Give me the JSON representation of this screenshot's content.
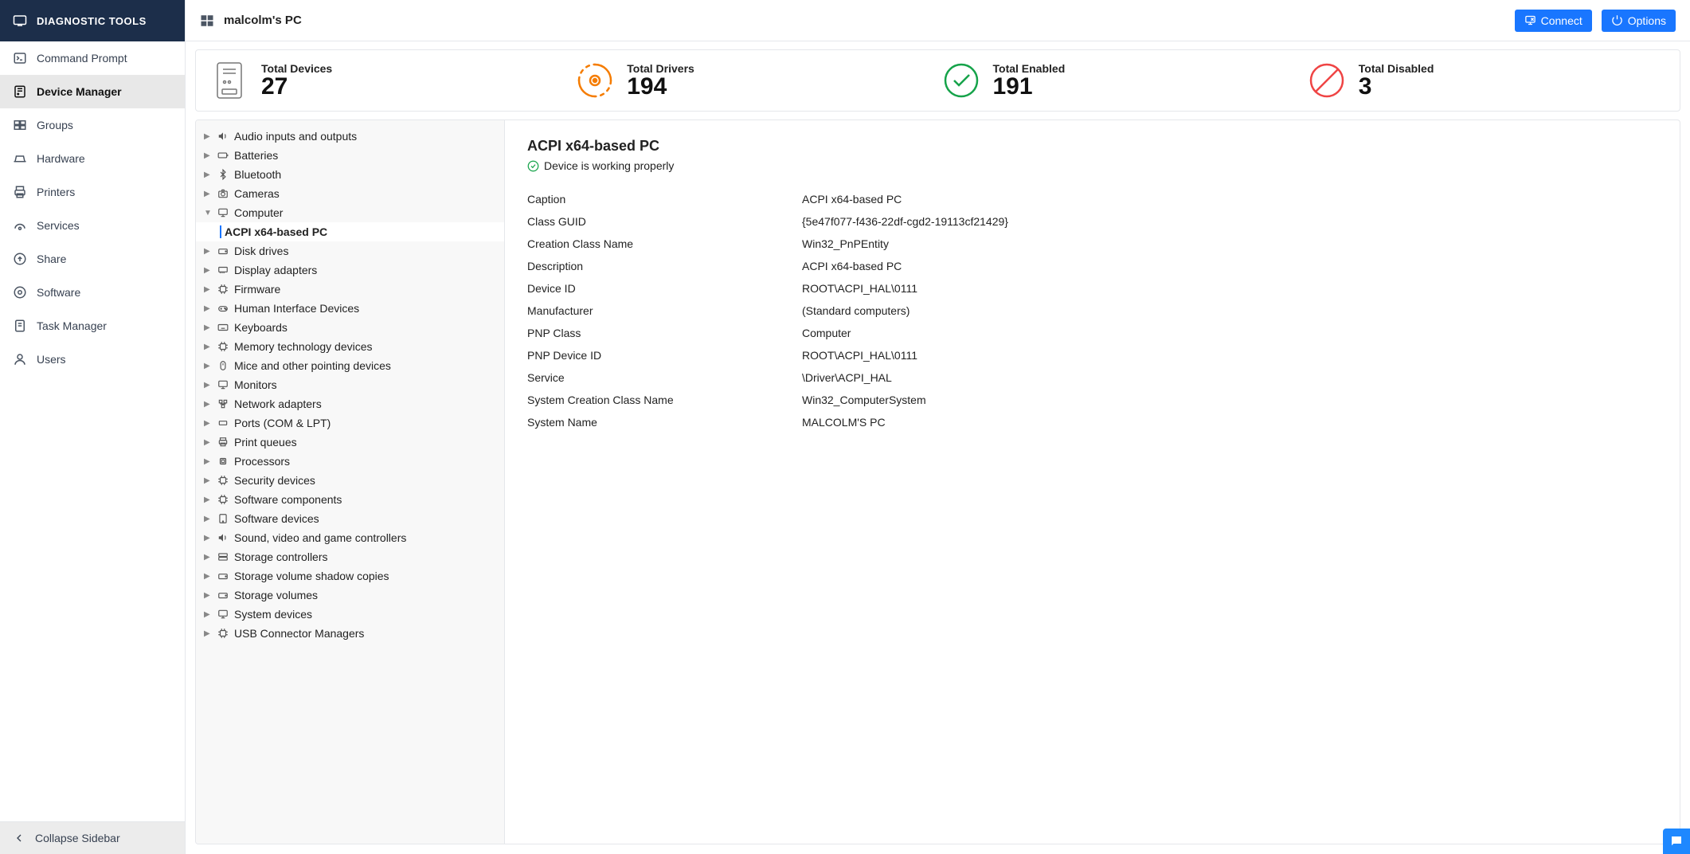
{
  "sidebar": {
    "title": "DIAGNOSTIC TOOLS",
    "items": [
      {
        "label": "Command Prompt"
      },
      {
        "label": "Device Manager"
      },
      {
        "label": "Groups"
      },
      {
        "label": "Hardware"
      },
      {
        "label": "Printers"
      },
      {
        "label": "Services"
      },
      {
        "label": "Share"
      },
      {
        "label": "Software"
      },
      {
        "label": "Task Manager"
      },
      {
        "label": "Users"
      }
    ],
    "collapse": "Collapse Sidebar"
  },
  "header": {
    "title": "malcolm's PC",
    "connect": "Connect",
    "options": "Options"
  },
  "stats": {
    "totalDevices": {
      "label": "Total Devices",
      "value": "27"
    },
    "totalDrivers": {
      "label": "Total Drivers",
      "value": "194"
    },
    "totalEnabled": {
      "label": "Total Enabled",
      "value": "191"
    },
    "totalDisabled": {
      "label": "Total Disabled",
      "value": "3"
    }
  },
  "tree": {
    "categories": [
      {
        "label": "Audio inputs and outputs"
      },
      {
        "label": "Batteries"
      },
      {
        "label": "Bluetooth"
      },
      {
        "label": "Cameras"
      },
      {
        "label": "Computer",
        "expanded": true,
        "children": [
          {
            "label": "ACPI x64-based PC",
            "selected": true
          }
        ]
      },
      {
        "label": "Disk drives"
      },
      {
        "label": "Display adapters"
      },
      {
        "label": "Firmware"
      },
      {
        "label": "Human Interface Devices"
      },
      {
        "label": "Keyboards"
      },
      {
        "label": "Memory technology devices"
      },
      {
        "label": "Mice and other pointing devices"
      },
      {
        "label": "Monitors"
      },
      {
        "label": "Network adapters"
      },
      {
        "label": "Ports (COM & LPT)"
      },
      {
        "label": "Print queues"
      },
      {
        "label": "Processors"
      },
      {
        "label": "Security devices"
      },
      {
        "label": "Software components"
      },
      {
        "label": "Software devices"
      },
      {
        "label": "Sound, video and game controllers"
      },
      {
        "label": "Storage controllers"
      },
      {
        "label": "Storage volume shadow copies"
      },
      {
        "label": "Storage volumes"
      },
      {
        "label": "System devices"
      },
      {
        "label": "USB Connector Managers"
      }
    ]
  },
  "details": {
    "title": "ACPI x64-based PC",
    "status": "Device is working properly",
    "rows": [
      {
        "k": "Caption",
        "v": "ACPI x64-based PC"
      },
      {
        "k": "Class GUID",
        "v": "{5e47f077-f436-22df-cgd2-19113cf21429}"
      },
      {
        "k": "Creation Class Name",
        "v": "Win32_PnPEntity"
      },
      {
        "k": "Description",
        "v": "ACPI x64-based PC"
      },
      {
        "k": "Device ID",
        "v": "ROOT\\ACPI_HAL\\0111"
      },
      {
        "k": "Manufacturer",
        "v": "(Standard computers)"
      },
      {
        "k": "PNP Class",
        "v": "Computer"
      },
      {
        "k": "PNP Device ID",
        "v": "ROOT\\ACPI_HAL\\0111"
      },
      {
        "k": "Service",
        "v": "\\Driver\\ACPI_HAL"
      },
      {
        "k": "System Creation Class Name",
        "v": "Win32_ComputerSystem"
      },
      {
        "k": "System Name",
        "v": "MALCOLM'S PC"
      }
    ]
  },
  "icons": {
    "tree": {
      "Audio inputs and outputs": "volume-icon",
      "Batteries": "battery-icon",
      "Bluetooth": "bluetooth-icon",
      "Cameras": "camera-icon",
      "Computer": "monitor-icon",
      "Disk drives": "disk-icon",
      "Display adapters": "display-adapter-icon",
      "Firmware": "chip-icon",
      "Human Interface Devices": "gamepad-icon",
      "Keyboards": "keyboard-icon",
      "Memory technology devices": "chip-icon",
      "Mice and other pointing devices": "mouse-icon",
      "Monitors": "monitor-icon",
      "Network adapters": "network-icon",
      "Ports (COM & LPT)": "port-icon",
      "Print queues": "printer-icon",
      "Processors": "cpu-icon",
      "Security devices": "chip-icon",
      "Software components": "chip-icon",
      "Software devices": "app-icon",
      "Sound, video and game controllers": "volume-icon",
      "Storage controllers": "storage-icon",
      "Storage volume shadow copies": "disk-icon",
      "Storage volumes": "disk-icon",
      "System devices": "monitor-icon",
      "USB Connector Managers": "chip-icon"
    }
  }
}
